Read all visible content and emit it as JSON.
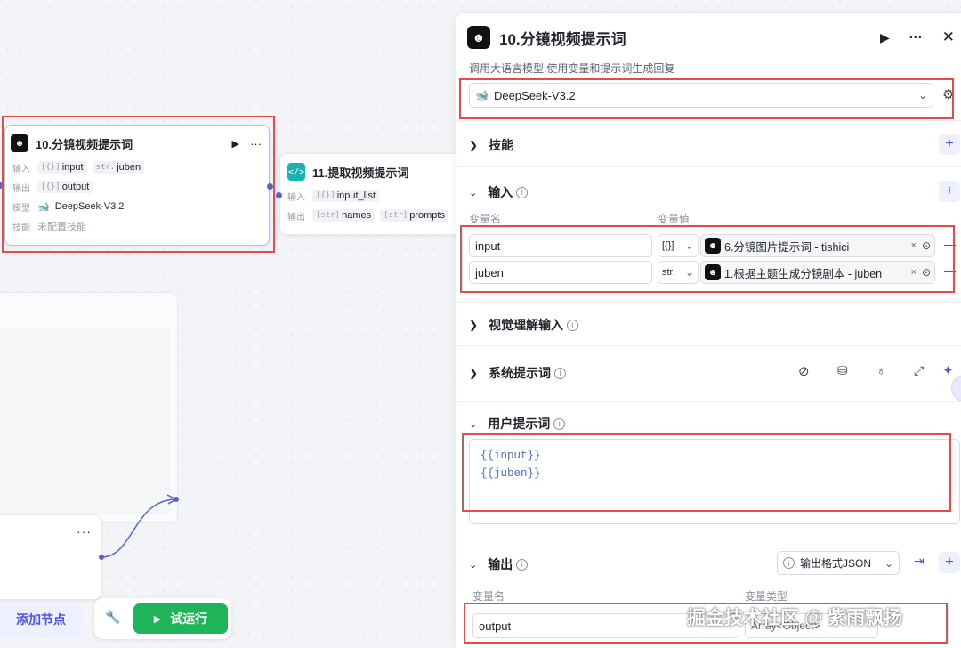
{
  "node10": {
    "title": "10.分镜视频提示词",
    "input_label": "输入",
    "input_tags": [
      {
        "type": "[{}]",
        "name": "input"
      },
      {
        "type": "str.",
        "name": "juben"
      }
    ],
    "output_label": "输出",
    "output_tag": {
      "type": "[{}]",
      "name": "output"
    },
    "model_label": "模型",
    "model_value": "DeepSeek-V3.2",
    "skill_label": "技能",
    "skill_value": "未配置技能"
  },
  "node11": {
    "title": "11.提取视频提示词",
    "input_label": "输入",
    "input_tag": {
      "type": "[{}]",
      "name": "input_list"
    },
    "output_label": "输出",
    "output_tags": [
      {
        "type": "[str]",
        "name": "names"
      },
      {
        "type": "[str]",
        "name": "prompts"
      }
    ]
  },
  "toolbar": {
    "add_node": "添加节点",
    "test_run": "试运行",
    "more": "···"
  },
  "panel": {
    "title": "10.分镜视频提示词",
    "subtitle": "调用大语言模型,使用变量和提示词生成回复",
    "model": "DeepSeek-V3.2",
    "skills_title": "技能",
    "input_title": "输入",
    "var_name_header": "变量名",
    "var_value_header": "变量值",
    "inputs": [
      {
        "name": "input",
        "type": "[{}]",
        "ref": "6.分镜图片提示词 - tishici"
      },
      {
        "name": "juben",
        "type": "str.",
        "ref": "1.根据主题生成分镜剧本 - juben"
      }
    ],
    "vision_title": "视觉理解输入",
    "system_prompt_title": "系统提示词",
    "user_prompt_title": "用户提示词",
    "user_prompt_lines": [
      "{{input}}",
      "{{juben}}"
    ],
    "output_title": "输出",
    "output_format": "输出格式JSON",
    "out_var_name_header": "变量名",
    "out_var_type_header": "变量类型",
    "outputs": [
      {
        "name": "output",
        "type": "Array<Object>"
      }
    ]
  },
  "watermark": "掘金技术社区 @ 紫雨飘扬",
  "colors": {
    "accent": "#4d53e8",
    "green": "#1fb35a",
    "red": "#e84a4a",
    "teal": "#17b3b3"
  }
}
